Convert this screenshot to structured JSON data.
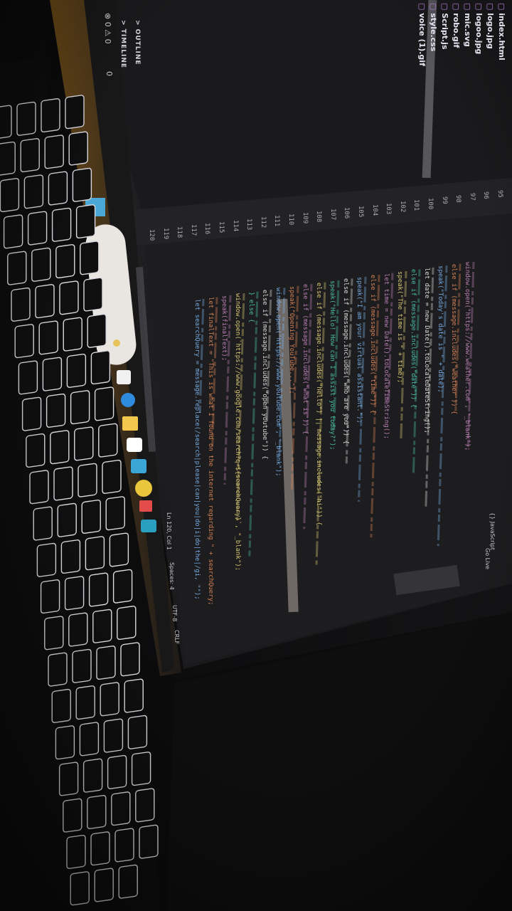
{
  "explorer": {
    "files": [
      {
        "name": "index.html",
        "icon": "html-file-icon"
      },
      {
        "name": "logo.jpg",
        "icon": "image-file-icon"
      },
      {
        "name": "logoo.jpg",
        "icon": "image-file-icon"
      },
      {
        "name": "mic.svg",
        "icon": "svg-file-icon"
      },
      {
        "name": "robo.gif",
        "icon": "image-file-icon"
      },
      {
        "name": "Script.js",
        "icon": "js-file-icon"
      },
      {
        "name": "style.css",
        "icon": "css-file-icon"
      },
      {
        "name": "voice (1).gif",
        "icon": "image-file-icon"
      }
    ],
    "outline_label": "> OUTLINE",
    "timeline_label": "> TIMELINE",
    "status_counts": "⊗ 0 ⚠ 0",
    "ports": "0"
  },
  "editor": {
    "line_numbers": [
      "120",
      "119",
      "118",
      "117",
      "116",
      "115",
      "114",
      "113",
      "112",
      "111",
      "110",
      "109",
      "108",
      "107",
      "106",
      "105",
      "104",
      "103",
      "102",
      "101",
      "100",
      "99",
      "98",
      "97",
      "96",
      "95"
    ],
    "code_lines": [
      "let searchQuery = message.replace(/search|please|can|you|do|i|do|the|/gi, \"\");",
      "let finalText = \"This is what I found on the internet regarding \" + searchQuery;",
      "speak(finalText);",
      "window.open(`https://www.google.com/search?q=${searchQuery}`, \"_blank\");",
      "} else {",
      "else if (message.includes(\"open youtube\")) {",
      "window.open(\"https://www.youtube.com\", \"_blank\");",
      "speak(\"Opening YouTube...\");",
      "else if (message.includes(\"what is\")) {",
      "else if (message.includes(\"hello\") || message.includes(\"hi\")) {",
      "speak(\"Hello! How can I assist you today?\");",
      "else if (message.includes(\"who are you\")) {",
      "speak(\"I am your virtual assistant.\");",
      "else if (message.includes(\"time\")) {",
      "let time = new Date().toLocaleTimeString();",
      "speak(\"The time is \" + time);",
      "else if (message.includes(\"date\")) {",
      "let date = new Date().toLocaleDateString();",
      "speak(\"Today's date is \" + date);",
      "else if (message.includes(\"weather\")) {",
      "window.open(\"https://www.weather.com\", \"_blank\");"
    ]
  },
  "statusbar": {
    "position": "Ln 120, Col 1",
    "spaces": "Spaces: 4",
    "encoding": "UTF-8",
    "eol": "CRLF",
    "language": "{} JavaScript",
    "live": "Go Live"
  },
  "taskbar": {
    "icons": [
      "windows-start-icon",
      "search-icon",
      "widgets-icon",
      "edge-icon",
      "file-explorer-icon",
      "store-icon",
      "vscode-icon",
      "chrome-icon",
      "photos-icon",
      "settings-icon"
    ]
  },
  "colors": {
    "background": "#0b0b0c",
    "editor_bg": "#1e1e1e",
    "keyboard_key": "#0f0f10",
    "key_outline": "#d9d9df",
    "taskbar_accent": "#7a5a20",
    "syntax_blue": "#7cb5f0",
    "syntax_orange": "#e0895a",
    "syntax_purple": "#c586c0",
    "syntax_yellow": "#e6d37a",
    "syntax_teal": "#4ec9b0",
    "syntax_white": "#e5e5e5"
  }
}
